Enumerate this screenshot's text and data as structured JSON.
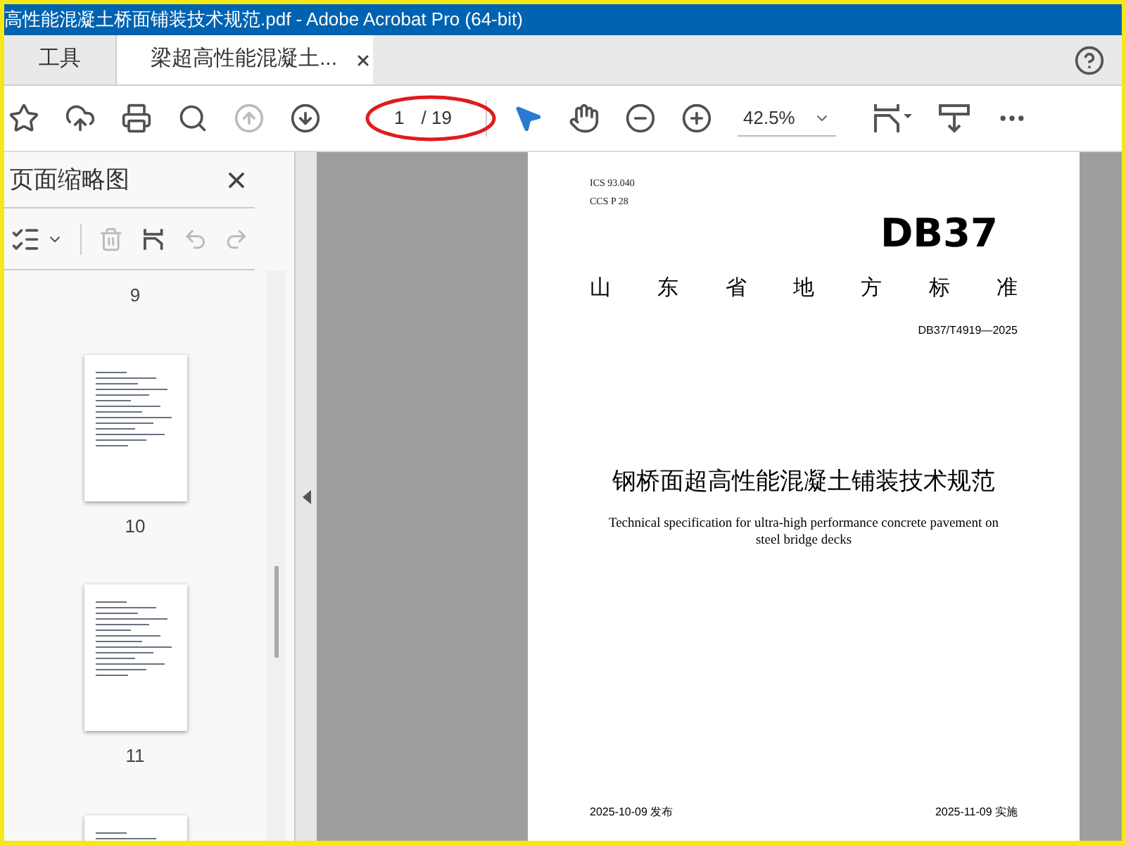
{
  "window": {
    "title": "高性能混凝土桥面铺装技术规范.pdf - Adobe Acrobat Pro (64-bit)"
  },
  "tabs": [
    {
      "label": "工具",
      "selected": false
    },
    {
      "label": "梁超高性能混凝土...",
      "selected": true
    }
  ],
  "toolbar": {
    "nav": [
      {
        "kind": "prev",
        "disabled": true
      },
      {
        "kind": "next",
        "disabled": false
      }
    ],
    "page_field": {
      "value": "1",
      "total": "/ 19"
    },
    "tools": [
      {
        "kind": "select",
        "selected": true
      },
      {
        "kind": "hand",
        "selected": false
      }
    ],
    "zoom": {
      "value": "42.5%"
    }
  },
  "thumbnail_panel": {
    "title": "页面缩略图",
    "actions": [
      {
        "kind": "delete",
        "disabled": true
      },
      {
        "kind": "insert",
        "disabled": false
      },
      {
        "kind": "undo",
        "disabled": true
      },
      {
        "kind": "redo",
        "disabled": true
      }
    ],
    "page_labels": [
      "9",
      "10",
      "11"
    ]
  },
  "document": {
    "ics": "ICS  93.040",
    "ccs": "CCS  P  28",
    "logo": "DB37",
    "authority": [
      "山",
      "东",
      "省",
      "地",
      "方",
      "标",
      "准"
    ],
    "code": "DB37/T4919—2025",
    "title": "钢桥面超高性能混凝土铺装技术规范",
    "subtitle": "Technical specification for ultra-high performance concrete pavement on steel bridge decks",
    "issued": "2025-10-09 发布",
    "effective": "2025-11-09 实施"
  }
}
